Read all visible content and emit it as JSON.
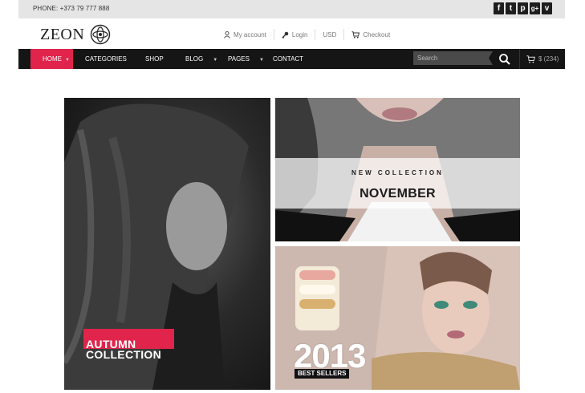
{
  "topbar": {
    "phone": "PHONE: +373 79 777 888",
    "socials": [
      {
        "icon": "facebook-icon",
        "glyph": "f"
      },
      {
        "icon": "tumblr-icon",
        "glyph": "t"
      },
      {
        "icon": "pinterest-icon",
        "glyph": "p"
      },
      {
        "icon": "google-plus-icon",
        "glyph": "g+"
      },
      {
        "icon": "vimeo-icon",
        "glyph": "v"
      }
    ]
  },
  "header": {
    "logo": "ZEON",
    "links": {
      "account": "My account",
      "login": "Login",
      "currency": "USD",
      "checkout": "Checkout"
    }
  },
  "nav": {
    "items": [
      "HOME",
      "CATEGORIES",
      "SHOP",
      "BLOG",
      "PAGES",
      "CONTACT"
    ],
    "search_placeholder": "Search",
    "cart": "$ (234)",
    "active_color": "#e0244b"
  },
  "banners": {
    "autumn": {
      "line1": "AUTUMN",
      "line2": "COLLECTION"
    },
    "november": {
      "sub": "NEW COLLECTION",
      "title": "NOVEMBER"
    },
    "bestsellers": {
      "year": "2013",
      "label": "BEST SELLERS"
    }
  }
}
